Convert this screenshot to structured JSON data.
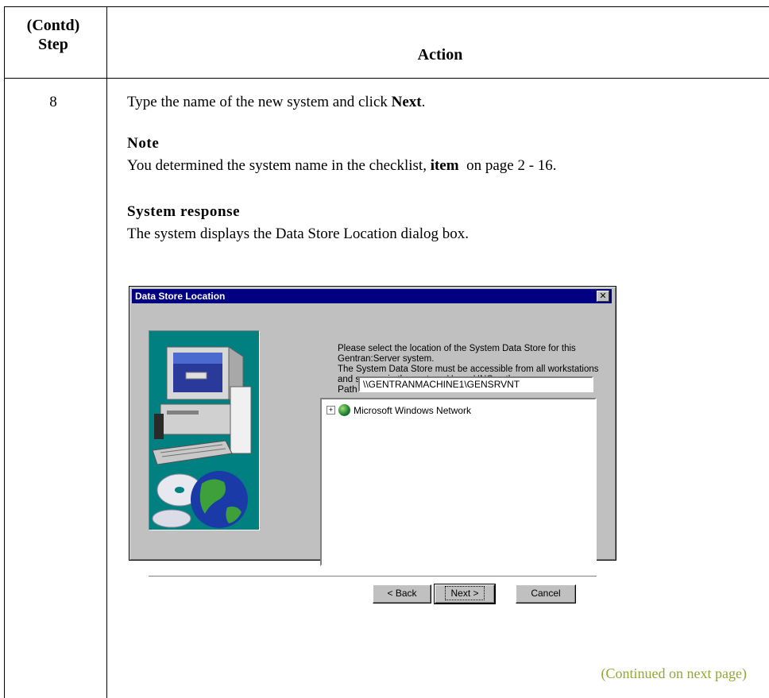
{
  "table": {
    "header": {
      "step_line1": "(Contd)",
      "step_line2": "Step",
      "action": "Action"
    },
    "step_number": "8"
  },
  "instruction": {
    "pre": "Type the name of the new system and click ",
    "button": "Next",
    "post": "."
  },
  "note": {
    "heading": "Note",
    "pre": "You determined the system name in the checklist, ",
    "bold": "item",
    "post": "  on page 2 - 16."
  },
  "system_response": {
    "heading": "System response",
    "text": "The system displays the Data Store Location dialog box."
  },
  "dialog": {
    "title": "Data Store Location",
    "close_glyph": "✕",
    "text1": "Please select the location of the System Data Store for this Gentran:Server system.",
    "text2": "The System Data Store must be accessible from all workstations and servers in the system. Use a UNC pathname.",
    "path_label": "Path",
    "path_value": "\\\\GENTRANMACHINE1\\GENSRVNT",
    "tree_item": "Microsoft Windows Network",
    "buttons": {
      "back": "< Back",
      "next": "Next >",
      "cancel": "Cancel"
    }
  },
  "continued": "(Continued on next page)"
}
